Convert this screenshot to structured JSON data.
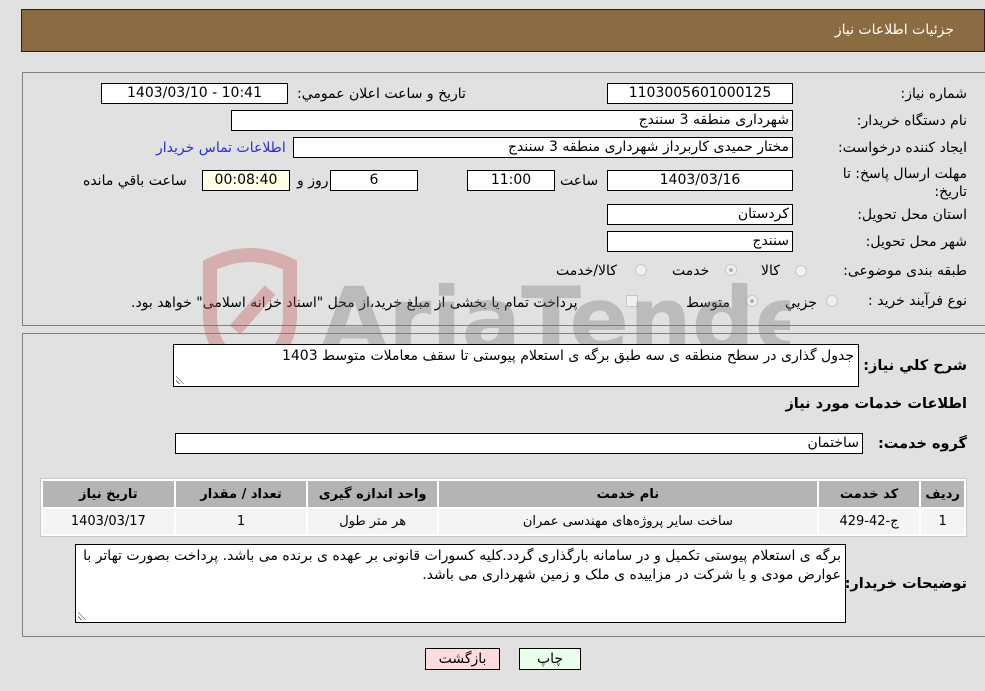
{
  "header": {
    "title": "جزئیات اطلاعات نیاز"
  },
  "form": {
    "need_number": {
      "label": "شماره نیاز:",
      "value": "1103005601000125"
    },
    "announce_datetime": {
      "label": "تاريخ و ساعت اعلان عمومي:",
      "value": "1403/03/10 - 10:41"
    },
    "buyer_org": {
      "label": "نام دستگاه خریدار:",
      "value": "شهرداری منطقه 3 سنندج"
    },
    "requester": {
      "label": "ایجاد کننده درخواست:",
      "value": "مختار حمیدی کاربرداز شهرداری منطقه 3 سنندج"
    },
    "buyer_contact_link": "اطلاعات تماس خریدار",
    "deadline": {
      "label": "مهلت ارسال پاسخ: تا تاریخ:",
      "date": "1403/03/16",
      "time_label": "ساعت",
      "time": "11:00",
      "days": "6",
      "days_label": "روز و",
      "remaining": "00:08:40",
      "remaining_label": "ساعت باقي مانده"
    },
    "province": {
      "label": "استان محل تحویل:",
      "value": "کردستان"
    },
    "city": {
      "label": "شهر محل تحویل:",
      "value": "سنندج"
    },
    "category": {
      "label": "طبقه بندی موضوعی:",
      "options": [
        "کالا",
        "خدمت",
        "کالا/خدمت"
      ],
      "selected": "خدمت"
    },
    "process_type": {
      "label": "نوع فرآیند خرید :",
      "options": [
        "جزيي",
        "متوسط"
      ],
      "selected": "متوسط",
      "treasury_checkbox_label": "پرداخت تمام یا بخشی از مبلغ خرید،از محل \"اسناد خزانه اسلامی\" خواهد بود.",
      "treasury_checked": false
    }
  },
  "details": {
    "description": {
      "label": "شرح کلي نياز:",
      "value": "جدول گذاری در سطح منطقه ی سه طبق برگه ی استعلام پیوستی تا سقف معاملات متوسط 1403"
    },
    "services_heading": "اطلاعات خدمات مورد نياز",
    "service_group": {
      "label": "گروه خدمت:",
      "value": "ساختمان"
    },
    "table": {
      "headers": [
        "ردیف",
        "کد خدمت",
        "نام خدمت",
        "واحد اندازه گیری",
        "تعداد / مقدار",
        "تاریخ نیاز"
      ],
      "rows": [
        [
          "1",
          "ج-42-429",
          "ساخت سایر پروژه‌های مهندسی عمران",
          "هر متر طول",
          "1",
          "1403/03/17"
        ]
      ]
    },
    "buyer_notes": {
      "label": "توضیحات خریدار:",
      "value": "برگه ی استعلام پیوستی تکمیل و در سامانه بارگذاری گردد.کلیه کسورات قانونی بر عهده ی برنده می باشد. پرداخت بصورت تهاتر با عوارض مودی و یا شرکت در مزاییده ی ملک و زمین شهرداری می باشد."
    }
  },
  "buttons": {
    "print": "چاپ",
    "back": "بازگشت"
  },
  "watermark": {
    "text": "AriaTender.net"
  }
}
